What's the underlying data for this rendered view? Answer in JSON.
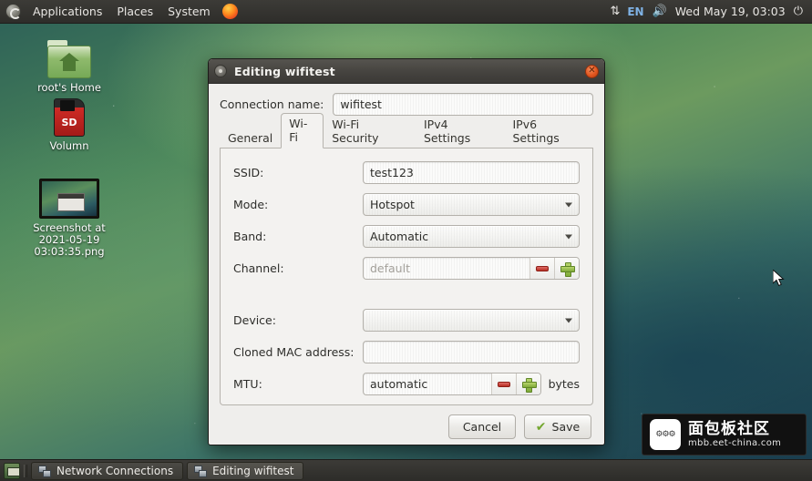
{
  "top_panel": {
    "logo_icon": "distro-logo-icon",
    "menus": [
      "Applications",
      "Places",
      "System"
    ],
    "firefox_icon": "firefox-icon",
    "network_icon": "network-updown-icon",
    "keyboard_layout": "EN",
    "volume_icon": "volume-icon",
    "clock": "Wed May 19, 03:03",
    "power_icon": "power-icon"
  },
  "desktop": {
    "icons": [
      {
        "label": "root's Home",
        "icon": "home-folder-icon"
      },
      {
        "label": "Volumn",
        "icon": "sd-card-icon",
        "badge": "SD"
      },
      {
        "label": "Screenshot at 2021-05-19 03:03:35.png",
        "icon": "image-file-icon"
      }
    ]
  },
  "dialog": {
    "title": "Editing wifitest",
    "close_icon": "close-icon",
    "connection_name_label": "Connection name:",
    "connection_name_value": "wifitest",
    "tabs": [
      {
        "label": "General",
        "active": false
      },
      {
        "label": "Wi-Fi",
        "active": true
      },
      {
        "label": "Wi-Fi Security",
        "active": false
      },
      {
        "label": "IPv4 Settings",
        "active": false
      },
      {
        "label": "IPv6 Settings",
        "active": false
      }
    ],
    "fields": {
      "ssid_label": "SSID:",
      "ssid_value": "test123",
      "mode_label": "Mode:",
      "mode_value": "Hotspot",
      "band_label": "Band:",
      "band_value": "Automatic",
      "channel_label": "Channel:",
      "channel_value": "default",
      "device_label": "Device:",
      "device_value": "",
      "cloned_mac_label": "Cloned MAC address:",
      "cloned_mac_value": "",
      "mtu_label": "MTU:",
      "mtu_value": "automatic",
      "mtu_unit": "bytes"
    },
    "buttons": {
      "cancel": "Cancel",
      "save": "Save",
      "save_icon": "check-icon",
      "minus_icon": "minus-icon",
      "plus_icon": "plus-icon"
    }
  },
  "taskbar": {
    "show_desktop_icon": "show-desktop-icon",
    "windows": [
      {
        "label": "Network Connections",
        "icon": "network-connections-icon",
        "active": false
      },
      {
        "label": "Editing wifitest",
        "icon": "network-connections-icon",
        "active": true
      }
    ]
  },
  "watermark": {
    "logo_icon": "mbb-logo-icon",
    "title": "面包板社区",
    "url": "mbb.eet-china.com"
  }
}
